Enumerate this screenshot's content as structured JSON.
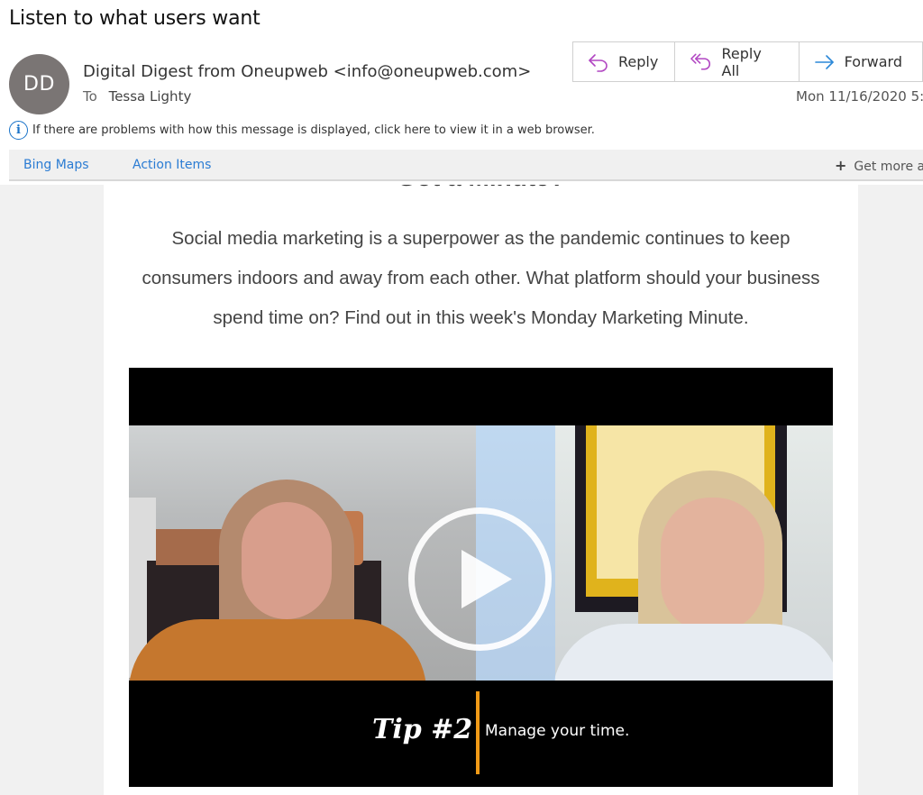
{
  "email": {
    "subject": "Listen to what users want",
    "avatar_initials": "DD",
    "sender": "Digital Digest from Oneupweb <info@oneupweb.com>",
    "to_label": "To",
    "recipient": "Tessa Lighty",
    "date": "Mon 11/16/2020 5:"
  },
  "actions": {
    "reply": {
      "label": "Reply",
      "icon": "reply-icon"
    },
    "reply_all": {
      "label": "Reply All",
      "icon": "reply-all-icon"
    },
    "forward": {
      "label": "Forward",
      "icon": "forward-icon"
    }
  },
  "info_bar": {
    "icon": "info-icon",
    "text": "If there are problems with how this message is displayed, click here to view it in a web browser."
  },
  "addins": {
    "items": [
      "Bing Maps",
      "Action Items"
    ],
    "get_more": "Get more ad"
  },
  "content": {
    "heading": "Got a Minute?",
    "intro": "Social media marketing is a superpower as the pandemic continues to keep consumers indoors and away from each other. What platform should your business spend time on? Find out in this week's Monday Marketing Minute."
  },
  "video": {
    "play_icon": "play-icon",
    "tip_number": "Tip #2",
    "tip_text": "Manage your time.",
    "accent_color": "#f09a17"
  },
  "colors": {
    "reply_icon": "#b146c2",
    "forward_icon": "#2b88d8",
    "link": "#2b7cd3",
    "avatar_bg": "#7a7574"
  }
}
